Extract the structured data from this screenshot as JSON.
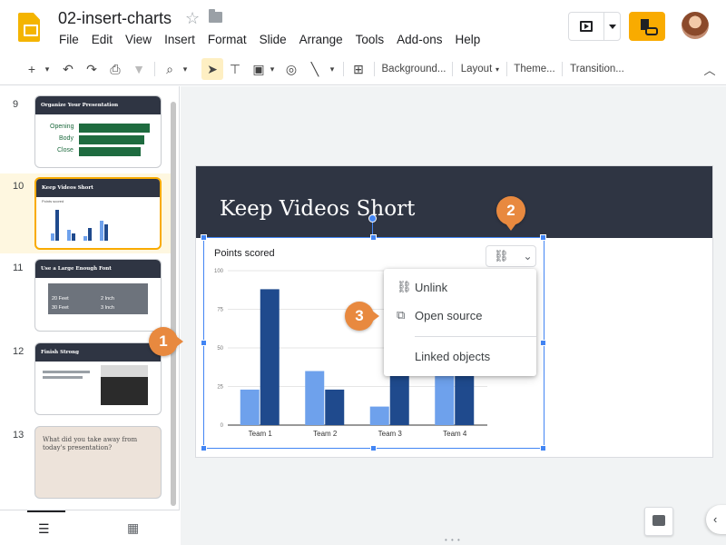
{
  "app": {
    "doc_title": "02-insert-charts",
    "menu": [
      "File",
      "Edit",
      "View",
      "Insert",
      "Format",
      "Slide",
      "Arrange",
      "Tools",
      "Add-ons",
      "Help"
    ]
  },
  "toolbar": {
    "background_label": "Background...",
    "layout_label": "Layout",
    "theme_label": "Theme...",
    "transition_label": "Transition..."
  },
  "filmstrip": {
    "slides": [
      {
        "number": "9",
        "title": "Organize Your Presentation",
        "rows": [
          "Opening",
          "Body",
          "Close"
        ]
      },
      {
        "number": "10",
        "title": "Keep Videos Short",
        "subtitle": "Points scored"
      },
      {
        "number": "11",
        "title": "Use a Large Enough Font",
        "table_cells": [
          "20 Feet",
          "2 Inch",
          "30 Feet",
          "3 Inch"
        ]
      },
      {
        "number": "12",
        "title": "Finish Strong"
      },
      {
        "number": "13",
        "title": "What did you take away from today's presentation?"
      }
    ]
  },
  "slide": {
    "title": "Keep Videos Short"
  },
  "chart_data": {
    "type": "bar",
    "title": "Points scored",
    "categories": [
      "Team 1",
      "Team 2",
      "Team 3",
      "Team 4"
    ],
    "series": [
      {
        "values": [
          23,
          35,
          12,
          40
        ]
      },
      {
        "values": [
          88,
          23,
          40,
          40
        ]
      }
    ],
    "y_ticks": [
      0,
      25,
      50,
      75,
      100
    ],
    "ylim": [
      0,
      100
    ],
    "colors": [
      "#6ea1ec",
      "#1f4a8d"
    ],
    "grid": true,
    "legend": "none"
  },
  "link_menu": {
    "unlink": "Unlink",
    "open_source": "Open source",
    "linked_objects": "Linked objects"
  },
  "callouts": {
    "one": "1",
    "two": "2",
    "three": "3",
    "color": "#e8893f"
  }
}
